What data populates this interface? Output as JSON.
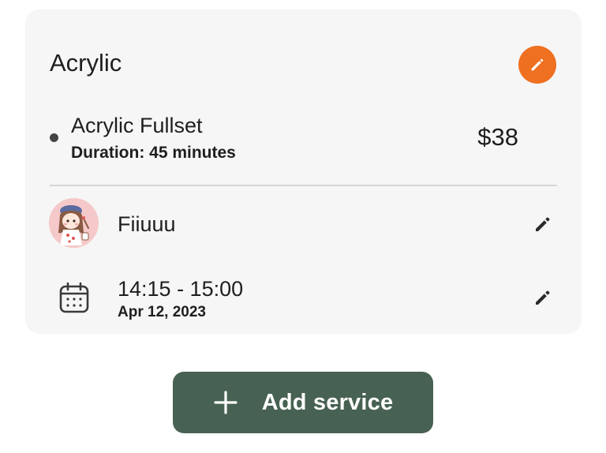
{
  "colors": {
    "card_background": "#f6f6f6",
    "accent_orange": "#ee7020",
    "add_button_green": "#476152",
    "avatar_background": "#f5c9c9"
  },
  "service_group": {
    "title": "Acrylic",
    "edit_icon": "pencil-icon"
  },
  "service": {
    "name": "Acrylic Fullset",
    "duration": "Duration: 45 minutes",
    "price": "$38"
  },
  "staff": {
    "name": "Fiiuuu",
    "avatar_icon": "avatar-illustration",
    "edit_icon": "pencil-icon"
  },
  "appointment": {
    "time": "14:15 - 15:00",
    "date": "Apr 12, 2023",
    "calendar_icon": "calendar-icon",
    "edit_icon": "pencil-icon"
  },
  "actions": {
    "add_service_label": "Add service",
    "add_icon": "plus-icon"
  }
}
